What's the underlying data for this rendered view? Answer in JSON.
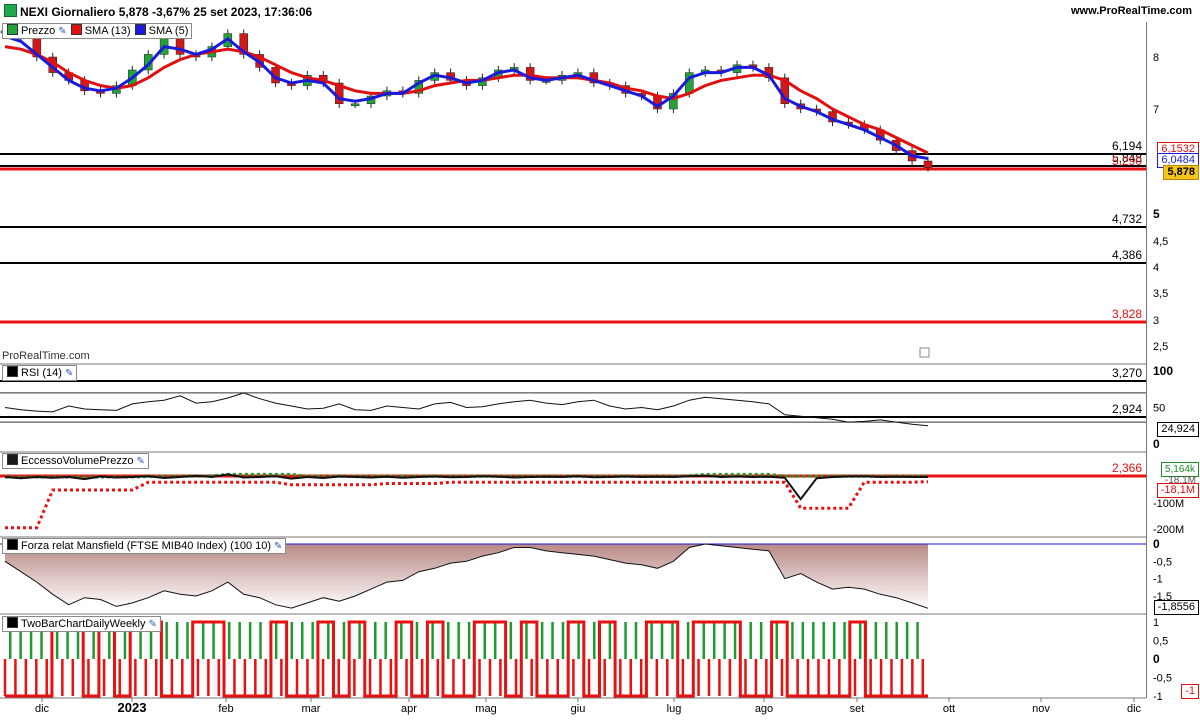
{
  "header": {
    "title": "NEXI Giornaliero 5,878 -3,67% 25 set 2023, 17:36:06",
    "site": "www.ProRealTime.com"
  },
  "watermark": "ProRealTime.com",
  "colors": {
    "price_sma": "#e01010",
    "fast_sma": "#1a1adb",
    "up": "#22a33a",
    "down": "#d01818",
    "h_black": "#000000",
    "h_red": "#e81010",
    "last_bg": "#f5c518"
  },
  "legends": {
    "main": [
      {
        "label": "Prezzo",
        "color": "#22a33a"
      },
      {
        "label": "SMA (13)",
        "color": "#e01010"
      },
      {
        "label": "SMA (5)",
        "color": "#1a1adb"
      }
    ],
    "rsi": "RSI (14)",
    "evp": "EccessoVolumePrezzo",
    "mansfield": "Forza relat Mansfield (FTSE MIB40 Index) (100 10)",
    "twobar": "TwoBarChartDailyWeekly"
  },
  "price_labels": {
    "sma13": "6,1532",
    "sma5": "6,0484",
    "last": "5,878",
    "rsi": "24,924",
    "evp_pos": "5,164k",
    "evp_neg": "-18,1M",
    "evp_mid": "-18,1M",
    "mansfield": "-1,8556",
    "twobar_val": "-1"
  },
  "chart_data": [
    {
      "type": "candlestick",
      "title": "NEXI Giornaliero",
      "x_ticks": [
        "dic",
        "2023",
        "feb",
        "mar",
        "apr",
        "mag",
        "giu",
        "lug",
        "ago",
        "set",
        "ott",
        "nov",
        "dic"
      ],
      "y_ticks": [
        "8",
        "7",
        "5",
        "4,5",
        "4",
        "3,5",
        "3",
        "2,5"
      ],
      "close_path": [
        8.5,
        8.35,
        8.0,
        7.7,
        7.55,
        7.35,
        7.3,
        7.45,
        7.75,
        8.05,
        8.35,
        8.05,
        8.0,
        8.2,
        8.45,
        8.05,
        7.8,
        7.5,
        7.45,
        7.65,
        7.5,
        7.1,
        7.1,
        7.25,
        7.35,
        7.3,
        7.55,
        7.7,
        7.55,
        7.45,
        7.6,
        7.75,
        7.8,
        7.55,
        7.55,
        7.65,
        7.7,
        7.5,
        7.45,
        7.3,
        7.25,
        7.0,
        7.3,
        7.7,
        7.75,
        7.7,
        7.85,
        7.8,
        7.6,
        7.1,
        7.0,
        6.95,
        6.75,
        6.7,
        6.6,
        6.4,
        6.2,
        6.0,
        5.878
      ],
      "sma13_path": [
        8.2,
        8.15,
        8.05,
        7.9,
        7.7,
        7.55,
        7.45,
        7.4,
        7.45,
        7.6,
        7.8,
        7.95,
        8.05,
        8.1,
        8.15,
        8.1,
        8.0,
        7.85,
        7.7,
        7.6,
        7.55,
        7.45,
        7.35,
        7.3,
        7.3,
        7.3,
        7.35,
        7.45,
        7.5,
        7.55,
        7.55,
        7.6,
        7.65,
        7.65,
        7.6,
        7.6,
        7.6,
        7.55,
        7.5,
        7.4,
        7.35,
        7.25,
        7.2,
        7.3,
        7.45,
        7.55,
        7.6,
        7.65,
        7.65,
        7.55,
        7.35,
        7.2,
        7.0,
        6.85,
        6.7,
        6.6,
        6.45,
        6.3,
        6.1532
      ],
      "sma5_path": [
        8.4,
        8.3,
        8.05,
        7.8,
        7.55,
        7.4,
        7.35,
        7.4,
        7.6,
        7.85,
        8.2,
        8.15,
        8.05,
        8.15,
        8.35,
        8.1,
        7.9,
        7.6,
        7.5,
        7.55,
        7.5,
        7.2,
        7.15,
        7.2,
        7.3,
        7.3,
        7.5,
        7.65,
        7.6,
        7.5,
        7.55,
        7.7,
        7.75,
        7.6,
        7.55,
        7.6,
        7.65,
        7.55,
        7.45,
        7.35,
        7.25,
        7.05,
        7.25,
        7.6,
        7.7,
        7.7,
        7.8,
        7.8,
        7.65,
        7.2,
        7.05,
        6.95,
        6.8,
        6.7,
        6.6,
        6.45,
        6.3,
        6.1,
        6.0484
      ],
      "levels": [
        {
          "value": "6,194",
          "color": "black"
        },
        {
          "value": "5,848",
          "color": "black"
        },
        {
          "value": "5,290",
          "color": "red"
        },
        {
          "value": "4,732",
          "color": "black"
        },
        {
          "value": "4,386",
          "color": "black"
        },
        {
          "value": "3,828",
          "color": "red"
        },
        {
          "value": "3,270",
          "color": "black"
        },
        {
          "value": "2,924",
          "color": "black"
        },
        {
          "value": "2,366",
          "color": "red"
        }
      ]
    },
    {
      "type": "line",
      "title": "RSI (14)",
      "y_ticks": [
        "100",
        "50",
        "0"
      ],
      "ylim": [
        0,
        100
      ],
      "values": [
        50,
        47,
        45,
        44,
        52,
        48,
        47,
        46,
        55,
        58,
        60,
        66,
        56,
        58,
        63,
        70,
        62,
        56,
        52,
        48,
        49,
        55,
        47,
        46,
        52,
        50,
        48,
        55,
        57,
        50,
        51,
        55,
        58,
        60,
        56,
        54,
        58,
        60,
        52,
        48,
        50,
        47,
        52,
        60,
        64,
        62,
        60,
        58,
        55,
        40,
        38,
        36,
        34,
        30,
        31,
        33,
        30,
        27,
        24.924
      ],
      "last": 24.924
    },
    {
      "type": "line",
      "title": "EccessoVolumePrezzo",
      "y_ticks": [
        "-100M",
        "-200M"
      ],
      "ylim": [
        -220,
        20
      ],
      "black_values": [
        0,
        -5,
        0,
        -3,
        0,
        -8,
        2,
        -2,
        0,
        3,
        -4,
        0,
        5,
        0,
        10,
        -2,
        0,
        3,
        -6,
        0,
        -4,
        2,
        0,
        -2,
        1,
        -3,
        0,
        2,
        -1,
        0,
        3,
        1,
        -2,
        0,
        1,
        0,
        3,
        -1,
        0,
        2,
        0,
        1,
        0,
        3,
        5,
        0,
        2,
        0,
        1,
        -3,
        -85,
        -5,
        0,
        2,
        3,
        0,
        1,
        0,
        0.005
      ],
      "red_dotted": [
        -195,
        -195,
        -195,
        -50,
        -50,
        -50,
        -50,
        -50,
        -50,
        -20,
        -20,
        -20,
        -20,
        -20,
        -20,
        -20,
        -20,
        -20,
        -30,
        -30,
        -30,
        -30,
        -30,
        -30,
        -25,
        -25,
        -25,
        -25,
        -20,
        -20,
        -20,
        -20,
        -20,
        -20,
        -20,
        -20,
        -20,
        -20,
        -20,
        -20,
        -20,
        -20,
        -20,
        -20,
        -20,
        -20,
        -20,
        -20,
        -20,
        -20,
        -120,
        -120,
        -120,
        -120,
        -20,
        -20,
        -20,
        -20,
        -18.1
      ],
      "green_dotted": [
        0,
        0,
        0,
        0,
        0,
        0,
        0,
        0,
        0,
        2,
        3,
        3,
        3,
        5,
        10,
        10,
        10,
        10,
        10,
        3,
        3,
        3,
        3,
        3,
        3,
        3,
        3,
        3,
        3,
        3,
        3,
        3,
        3,
        3,
        3,
        3,
        3,
        3,
        3,
        3,
        3,
        3,
        3,
        5,
        10,
        10,
        10,
        10,
        10,
        3,
        3,
        3,
        3,
        3,
        3,
        3,
        3,
        3,
        5.164
      ]
    },
    {
      "type": "area",
      "title": "Forza relat Mansfield (FTSE MIB40 Index) (100 10)",
      "y_ticks": [
        "0",
        "-0,5",
        "-1",
        "-1,5"
      ],
      "ylim": [
        -1.9,
        0.1
      ],
      "values": [
        -0.5,
        -0.8,
        -1.1,
        -1.45,
        -1.75,
        -1.55,
        -1.6,
        -1.8,
        -1.7,
        -1.55,
        -1.35,
        -1.45,
        -1.5,
        -1.35,
        -1.1,
        -1.45,
        -1.55,
        -1.75,
        -1.85,
        -1.7,
        -1.55,
        -1.65,
        -1.5,
        -1.3,
        -1.1,
        -1.05,
        -0.8,
        -0.7,
        -0.55,
        -0.5,
        -0.35,
        -0.25,
        -0.1,
        -0.1,
        -0.2,
        -0.25,
        -0.3,
        -0.35,
        -0.45,
        -0.55,
        -0.6,
        -0.7,
        -0.5,
        -0.1,
        0.0,
        -0.05,
        -0.1,
        -0.15,
        -0.2,
        -1.0,
        -0.85,
        -1.1,
        -1.3,
        -1.25,
        -1.3,
        -1.45,
        -1.55,
        -1.7,
        -1.8556
      ],
      "last": -1.8556
    },
    {
      "type": "line",
      "title": "TwoBarChartDailyWeekly",
      "y_ticks": [
        "1",
        "0,5",
        "0",
        "-0,5",
        "-1"
      ],
      "ylim": [
        -1,
        1
      ],
      "weekly_state": [
        -1,
        -1,
        -1,
        1,
        1,
        -1,
        1,
        -1,
        1,
        1,
        -1,
        -1,
        1,
        1,
        -1,
        -1,
        -1,
        1,
        -1,
        -1,
        1,
        -1,
        1,
        -1,
        -1,
        1,
        -1,
        1,
        -1,
        -1,
        1,
        1,
        -1,
        1,
        -1,
        -1,
        1,
        -1,
        1,
        -1,
        -1,
        1,
        1,
        -1,
        1,
        1,
        1,
        -1,
        -1,
        1,
        -1,
        -1,
        -1,
        -1,
        1,
        -1,
        -1,
        -1,
        -1
      ]
    }
  ]
}
